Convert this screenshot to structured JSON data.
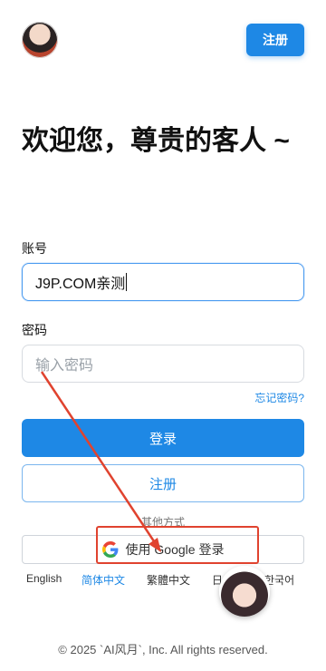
{
  "header": {
    "register_label": "注册"
  },
  "title": "欢迎您，尊贵的客人 ~",
  "account": {
    "label": "账号",
    "value": "J9P.COM亲测"
  },
  "password": {
    "label": "密码",
    "placeholder": "输入密码",
    "forgot_label": "忘记密码?"
  },
  "actions": {
    "login_label": "登录",
    "register_label": "注册"
  },
  "other": {
    "label": "其他方式",
    "google_label": "使用 Google 登录"
  },
  "languages": [
    {
      "label": "English",
      "active": false
    },
    {
      "label": "简体中文",
      "active": true
    },
    {
      "label": "繁體中文",
      "active": false
    },
    {
      "label": "日",
      "active": false
    },
    {
      "label": "한국어",
      "active": false
    }
  ],
  "footer": "© 2025 `AI风月`, Inc. All rights reserved.",
  "colors": {
    "accent": "#1e88e5",
    "annotation": "#e0432f"
  }
}
